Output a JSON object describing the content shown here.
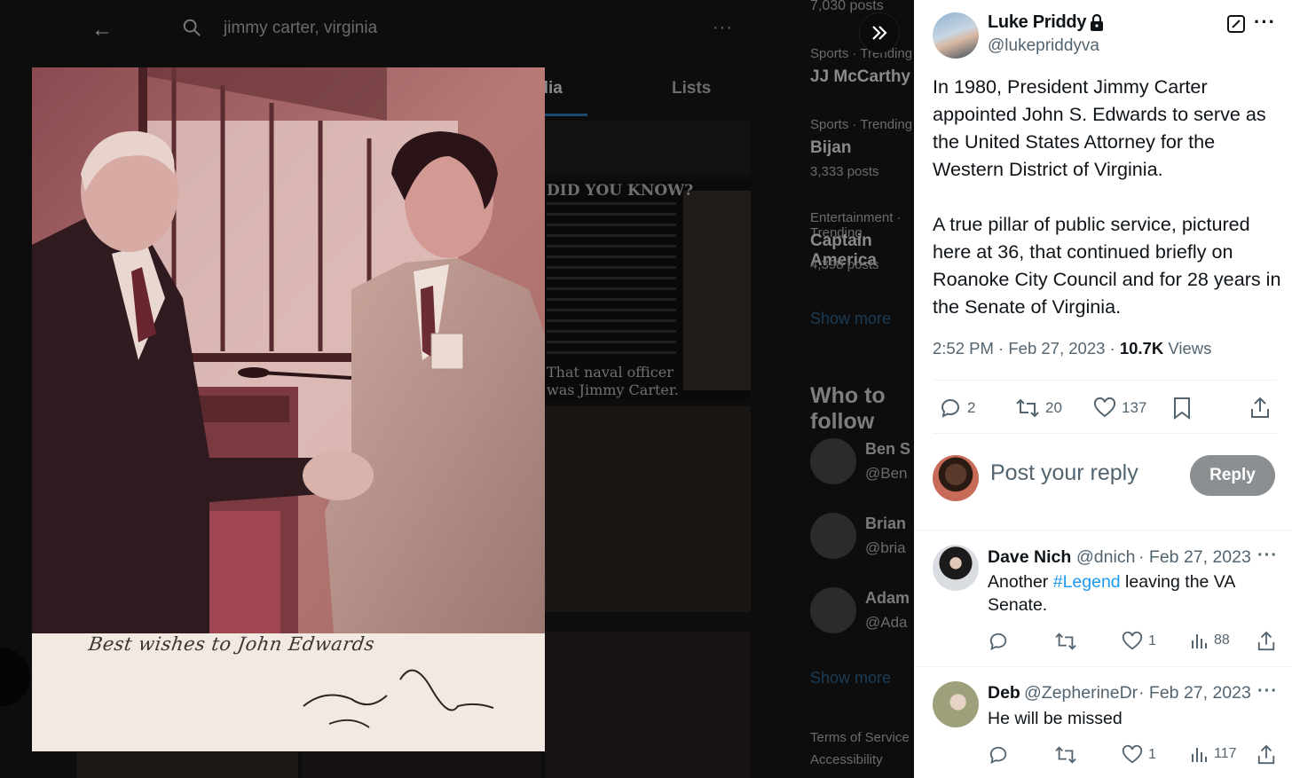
{
  "background": {
    "search_query": "jimmy carter, virginia",
    "tabs": [
      {
        "label": "Media"
      },
      {
        "label": "Lists"
      }
    ],
    "trends": [
      {
        "category": "Sports · Trending",
        "name": "JJ McCarthy",
        "count": ""
      },
      {
        "category": "Sports · Trending",
        "name": "Bijan",
        "count": "3,333 posts"
      },
      {
        "category": "Entertainment · Trending",
        "name": "Captain America",
        "count": "4,398 posts"
      }
    ],
    "top_count": "7,030 posts",
    "show_more_1": "Show more",
    "who_to_follow_title": "Who to follow",
    "follow_suggestions": [
      {
        "name": "Ben S",
        "handle": "@Ben"
      },
      {
        "name": "Brian",
        "handle": "@bria"
      },
      {
        "name": "Adam",
        "handle": "@Ada"
      }
    ],
    "show_more_2": "Show more",
    "footer": [
      "Terms of Service",
      "Accessibility"
    ],
    "did_you_know": {
      "title": "DID YOU KNOW?",
      "closing_1": "That naval officer",
      "closing_2": "was Jimmy Carter."
    }
  },
  "photo": {
    "inscription": "Best wishes to John Edwards",
    "signature": "Jimmy Carter"
  },
  "tweet": {
    "author_name": "Luke Priddy",
    "author_handle": "@lukepriddyva",
    "text": "In 1980, President Jimmy Carter appointed John S. Edwards to serve as the United States Attorney for the Western District of Virginia.\n\nA true pillar of public service, pictured here at 36, that continued briefly on Roanoke City Council and for 28 years in the Senate of Virginia.",
    "time": "2:52 PM",
    "date": "Feb 27, 2023",
    "views_count": "10.7K",
    "views_label": "Views",
    "replies": "2",
    "reposts": "20",
    "likes": "137"
  },
  "composer": {
    "placeholder": "Post your reply",
    "button_label": "Reply"
  },
  "replies": [
    {
      "name": "Dave Nich",
      "handle": "@dnich",
      "date": "Feb 27, 2023",
      "text_before": "Another ",
      "hashtag": "#Legend",
      "text_after": " leaving the VA Senate.",
      "likes": "1",
      "views": "88"
    },
    {
      "name": "Deb",
      "handle": "@ZepherineDr",
      "date": "Feb 27, 2023",
      "text": "He will be missed",
      "likes": "1",
      "views": "117"
    }
  ],
  "colors": {
    "accent": "#1d9bf0",
    "secondary_text": "#536471",
    "reply_button": "#8b8f92"
  }
}
